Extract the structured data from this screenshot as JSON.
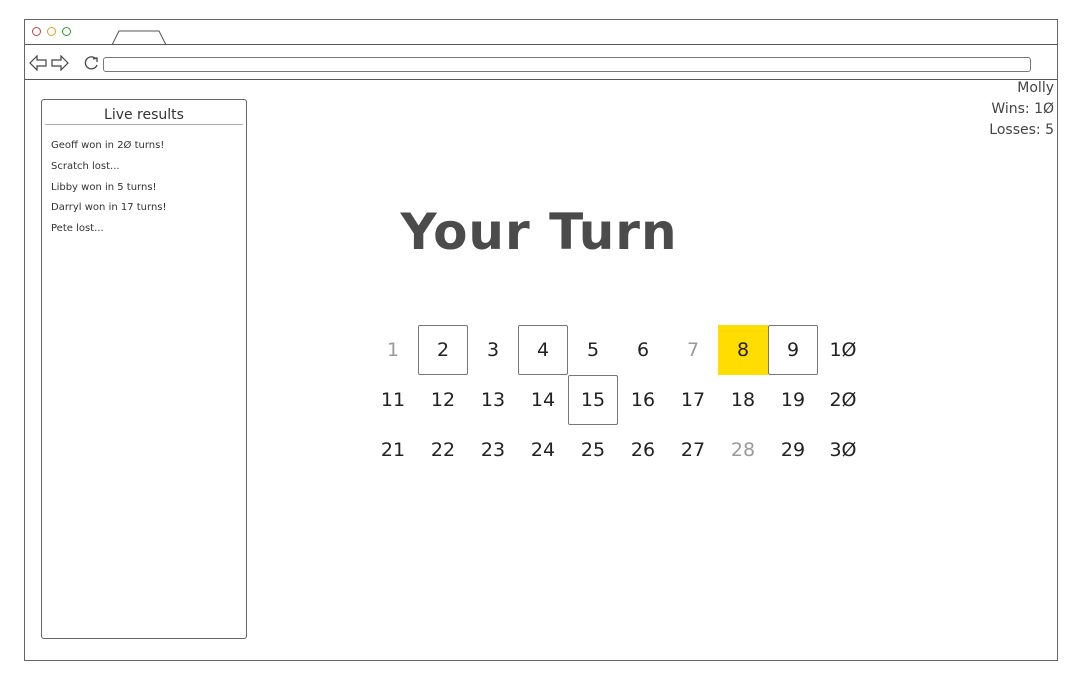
{
  "panel": {
    "title": "Live results",
    "results": [
      "Geoff won in 2Ø turns!",
      "Scratch lost...",
      "Libby won in 5 turns!",
      "Darryl won in 17 turns!",
      "Pete lost..."
    ]
  },
  "user": {
    "name": "Molly",
    "wins": "Wins: 1Ø",
    "losses": "Losses: 5"
  },
  "heading": "Your Turn",
  "colors": {
    "highlight": "#ffdd00",
    "muted": "#9a9a9a",
    "dot_red": "#d23c3c",
    "dot_yellow": "#e0a020",
    "dot_green": "#2a9a2a"
  },
  "board": [
    {
      "label": "1",
      "state": "muted"
    },
    {
      "label": "2",
      "state": "boxed"
    },
    {
      "label": "3",
      "state": "normal"
    },
    {
      "label": "4",
      "state": "boxed"
    },
    {
      "label": "5",
      "state": "normal"
    },
    {
      "label": "6",
      "state": "normal"
    },
    {
      "label": "7",
      "state": "muted"
    },
    {
      "label": "8",
      "state": "highlighted"
    },
    {
      "label": "9",
      "state": "boxed"
    },
    {
      "label": "1Ø",
      "state": "normal"
    },
    {
      "label": "11",
      "state": "normal"
    },
    {
      "label": "12",
      "state": "normal"
    },
    {
      "label": "13",
      "state": "normal"
    },
    {
      "label": "14",
      "state": "normal"
    },
    {
      "label": "15",
      "state": "boxed"
    },
    {
      "label": "16",
      "state": "normal"
    },
    {
      "label": "17",
      "state": "normal"
    },
    {
      "label": "18",
      "state": "normal"
    },
    {
      "label": "19",
      "state": "normal"
    },
    {
      "label": "2Ø",
      "state": "normal"
    },
    {
      "label": "21",
      "state": "normal"
    },
    {
      "label": "22",
      "state": "normal"
    },
    {
      "label": "23",
      "state": "normal"
    },
    {
      "label": "24",
      "state": "normal"
    },
    {
      "label": "25",
      "state": "normal"
    },
    {
      "label": "26",
      "state": "normal"
    },
    {
      "label": "27",
      "state": "normal"
    },
    {
      "label": "28",
      "state": "muted"
    },
    {
      "label": "29",
      "state": "normal"
    },
    {
      "label": "3Ø",
      "state": "normal"
    }
  ]
}
